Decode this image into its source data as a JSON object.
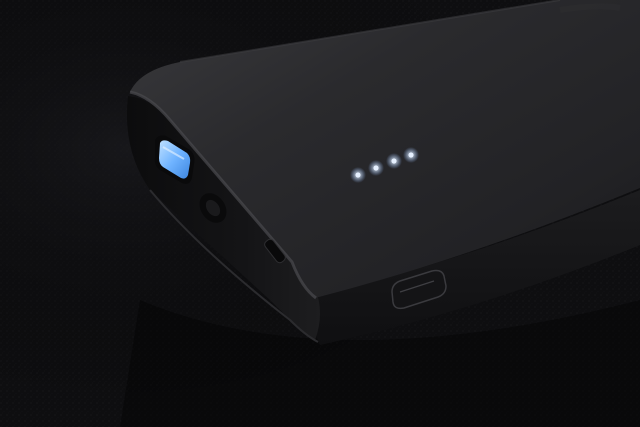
{
  "photo": {
    "subject": "power-bank",
    "charge_indicator": {
      "leds_lit": 4,
      "leds_total": 4,
      "led_color": "#cfe3ff"
    },
    "usb_a_port_light_color": "#6fb3ff",
    "colors": {
      "background": "#0d0d0f",
      "body": "#1e1e20",
      "body_highlight": "#3a3a3d"
    }
  }
}
